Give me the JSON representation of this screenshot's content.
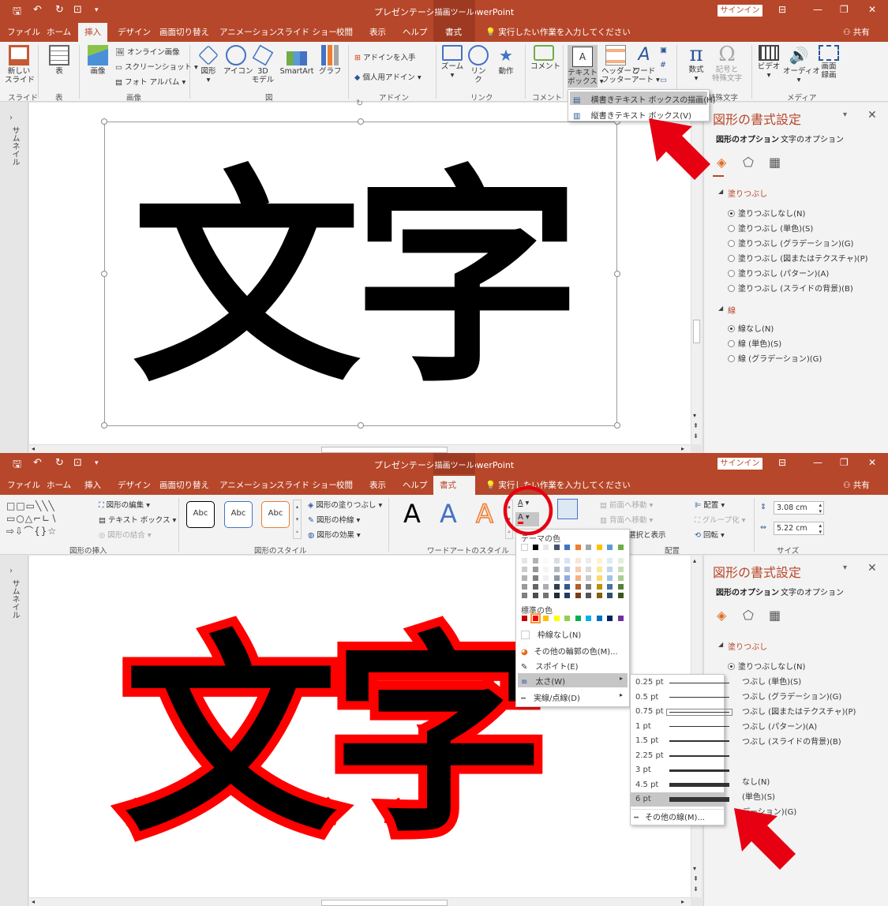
{
  "top": {
    "title": "プレゼンテーション1 - PowerPoint",
    "context_tab_header": "描画ツール",
    "signin": "サインイン",
    "tabs": [
      "ファイル",
      "ホーム",
      "挿入",
      "デザイン",
      "画面切り替え",
      "アニメーション",
      "スライド ショー",
      "校閲",
      "表示",
      "ヘルプ",
      "書式"
    ],
    "tellme": "実行したい作業を入力してください",
    "share": "共有",
    "ribbon": {
      "new_slide": "新しい\nスライド",
      "table": "表",
      "image": "画像",
      "online_image": "オンライン画像",
      "screenshot": "スクリーンショット",
      "photo_album": "フォト アルバム",
      "shapes": "図形",
      "icons": "アイコン",
      "model3d": "3D\nモデル",
      "smartart": "SmartArt",
      "chart": "グラフ",
      "get_addin": "アドインを入手",
      "my_addin": "個人用アドイン",
      "zoom": "ズーム",
      "link": "リン\nク",
      "action": "動作",
      "comment": "コメント",
      "textbox": "テキスト\nボックス",
      "header_footer": "ヘッダーと\nフッター",
      "wordart": "ワード\nアート",
      "equation": "数式",
      "symbol": "記号と\n特殊文字",
      "video": "ビデオ",
      "audio": "オーディオ",
      "screen_recording": "画面\n録画",
      "groups": [
        "スライド",
        "表",
        "画像",
        "図",
        "アドイン",
        "リンク",
        "コメント",
        "特殊文字",
        "メディア"
      ]
    },
    "textbox_menu": [
      "横書きテキスト ボックスの描画(H)",
      "縦書きテキスト ボックス(V)"
    ],
    "thumbnail": "サムネイル",
    "slide_text": "文字"
  },
  "format_pane": {
    "title": "図形の書式設定",
    "tab_shape": "図形のオプション",
    "tab_text": "文字のオプション",
    "fill_section": "塗りつぶし",
    "fill_options": [
      "塗りつぶしなし(N)",
      "塗りつぶし (単色)(S)",
      "塗りつぶし (グラデーション)(G)",
      "塗りつぶし (図またはテクスチャ)(P)",
      "塗りつぶし (パターン)(A)",
      "塗りつぶし (スライドの背景)(B)"
    ],
    "line_section": "線",
    "line_options": [
      "線なし(N)",
      "線 (単色)(S)",
      "線 (グラデーション)(G)"
    ]
  },
  "bottom": {
    "ribbon": {
      "edit_shape": "図形の編集",
      "text_box": "テキスト ボックス",
      "merge_shapes": "図形の結合",
      "style_sample": "Abc",
      "shape_fill": "図形の塗りつぶし",
      "shape_outline": "図形の枠線",
      "shape_effect": "図形の効果",
      "wordart_sample": "A",
      "bring_forward": "前面へ移動",
      "send_backward": "背面へ移動",
      "selection_pane": "ェクトの選択と表示",
      "align": "配置",
      "group": "グループ化",
      "rotate": "回転",
      "height": "3.08 cm",
      "width": "5.22 cm",
      "groups": [
        "図形の挿入",
        "図形のスタイル",
        "ワードアートのスタイル",
        "配置",
        "サイズ"
      ]
    },
    "color_menu": {
      "theme_colors": "テーマの色",
      "standard_colors": "標準の色",
      "no_outline": "枠線なし(N)",
      "more_colors": "その他の輪郭の色(M)...",
      "eyedropper": "スポイト(E)",
      "weight": "太さ(W)",
      "dashes": "実線/点線(D)"
    },
    "weights": [
      "0.25 pt",
      "0.5 pt",
      "0.75 pt",
      "1 pt",
      "1.5 pt",
      "2.25 pt",
      "3 pt",
      "4.5 pt",
      "6 pt"
    ],
    "more_lines": "その他の線(M)...",
    "partial_fill_options": [
      "塗りつぶしなし(N)",
      "つぶし (単色)(S)",
      "つぶし (グラデーション)(G)",
      "つぶし (図またはテクスチャ)(P)",
      "つぶし (パターン)(A)",
      "つぶし (スライドの背景)(B)"
    ],
    "partial_line_options": [
      "なし(N)",
      "(単色)(S)",
      "デーション)(G)"
    ]
  },
  "colors": {
    "accent": "#b7472a",
    "context": "#9f3a22",
    "ribbon_bg": "#f3f3f3",
    "outline": "#ff0000",
    "annotation": "#e60012",
    "theme_top": [
      "#ffffff",
      "#000000",
      "#e7e6e6",
      "#44546a",
      "#4472c4",
      "#ed7d31",
      "#a5a5a5",
      "#ffc000",
      "#5b9bd5",
      "#70ad47"
    ],
    "standard": [
      "#c00000",
      "#ff0000",
      "#ffc000",
      "#ffff00",
      "#92d050",
      "#00b050",
      "#00b0f0",
      "#0070c0",
      "#002060",
      "#7030a0"
    ]
  }
}
